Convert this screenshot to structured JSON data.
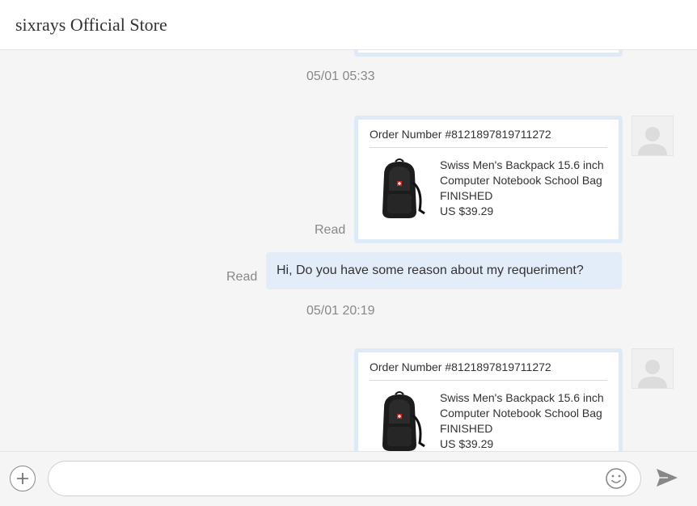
{
  "header": {
    "title": "sixrays Official Store"
  },
  "conversation": {
    "timestamps": [
      "05/01 05:33",
      "05/01 20:19"
    ],
    "read_label": "Read",
    "orders": [
      {
        "order_number": "Order Number #8121897819711272",
        "product_name": "Swiss Men's Backpack 15.6 inch Computer Notebook School Bag",
        "status": "FINISHED",
        "price": "US $39.29"
      },
      {
        "order_number": "Order Number #8121897819711272",
        "product_name": "Swiss Men's Backpack 15.6 inch Computer Notebook School Bag",
        "status": "FINISHED",
        "price": "US $39.29"
      }
    ],
    "message": {
      "text": "Hi, Do you have some reason about my requeriment?"
    }
  },
  "composer": {
    "input_value": "",
    "input_placeholder": "",
    "icons": {
      "add": "plus-circle-icon",
      "emoji": "smiley-icon",
      "send": "send-arrow-icon"
    }
  },
  "colors": {
    "card_border": "#dfeaf8",
    "bubble_bg": "#e3edf9",
    "background": "#f5f5f5",
    "meta_text": "#888888"
  }
}
